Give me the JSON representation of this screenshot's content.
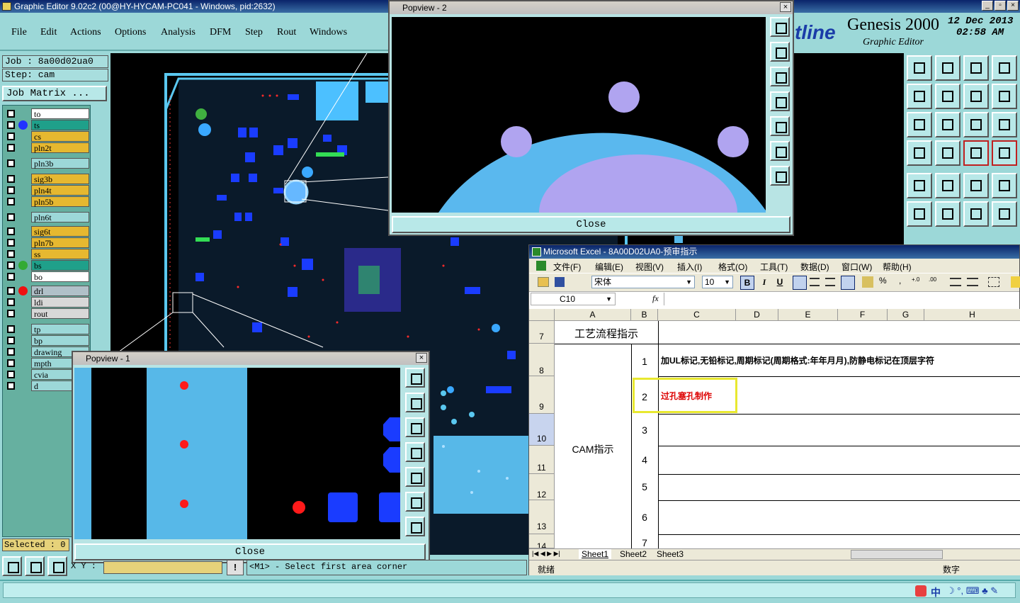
{
  "main_window": {
    "title": "Graphic Editor 9.02c2 (00@HY-HYCAM-PC041 - Windows, pid:2632)",
    "menu": [
      "File",
      "Edit",
      "Actions",
      "Options",
      "Analysis",
      "DFM",
      "Step",
      "Rout",
      "Windows"
    ]
  },
  "brand": {
    "partial_logo": "tline",
    "product": "Genesis 2000",
    "subtitle": "Graphic Editor",
    "date": "12 Dec 2013",
    "time": "02:58 AM"
  },
  "job": {
    "job_label": "Job : 8a00d02ua0",
    "step_label": "Step: cam",
    "matrix_button": "Job Matrix ..."
  },
  "layers": [
    {
      "name": "to",
      "bg": "#ffffff",
      "dot": ""
    },
    {
      "name": "ts",
      "bg": "#1fa08a",
      "dot": "#2233ff"
    },
    {
      "name": "cs",
      "bg": "#e6b830",
      "dot": ""
    },
    {
      "name": "pln2t",
      "bg": "#e6b830",
      "dot": ""
    },
    {
      "name": "pln3b",
      "bg": "#9cd8d8",
      "dot": ""
    },
    {
      "name": "sig3b",
      "bg": "#e6b830",
      "dot": ""
    },
    {
      "name": "pln4t",
      "bg": "#e6b830",
      "dot": ""
    },
    {
      "name": "pln5b",
      "bg": "#e6b830",
      "dot": ""
    },
    {
      "name": "pln6t",
      "bg": "#9cd8d8",
      "dot": ""
    },
    {
      "name": "sig6t",
      "bg": "#e6b830",
      "dot": ""
    },
    {
      "name": "pln7b",
      "bg": "#e6b830",
      "dot": ""
    },
    {
      "name": "ss",
      "bg": "#e6b830",
      "dot": ""
    },
    {
      "name": "bs",
      "bg": "#1fa08a",
      "dot": "#33aa33"
    },
    {
      "name": "bo",
      "bg": "#ffffff",
      "dot": ""
    },
    {
      "name": "drl",
      "bg": "#b0c0c8",
      "dot": "#ee1111"
    },
    {
      "name": "ldi",
      "bg": "#d8d8d8",
      "dot": ""
    },
    {
      "name": "rout",
      "bg": "#d8d8d8",
      "dot": ""
    },
    {
      "name": "tp",
      "bg": "#9cd8d8",
      "dot": ""
    },
    {
      "name": "bp",
      "bg": "#9cd8d8",
      "dot": ""
    },
    {
      "name": "drawing",
      "bg": "#9cd8d8",
      "dot": ""
    },
    {
      "name": "mpth",
      "bg": "#9cd8d8",
      "dot": ""
    },
    {
      "name": "cvia",
      "bg": "#9cd8d8",
      "dot": ""
    },
    {
      "name": "d",
      "bg": "#9cd8d8",
      "dot": ""
    }
  ],
  "selected_label": "Selected : 0",
  "coord_label": "X Y :",
  "prompt_text": "<M1> - Select first area corner",
  "popview2": {
    "title": "Popview - 2",
    "close": "Close"
  },
  "popview1": {
    "title": "Popview - 1",
    "close": "Close"
  },
  "excel": {
    "title": "Microsoft Excel - 8A00D02UA0-预审指示",
    "menu": [
      "文件(F)",
      "编辑(E)",
      "视图(V)",
      "插入(I)",
      "格式(O)",
      "工具(T)",
      "数据(D)",
      "窗口(W)",
      "帮助(H)"
    ],
    "font_name": "宋体",
    "font_size": "10",
    "cell_ref": "C10",
    "fx": "fx",
    "columns": [
      "A",
      "B",
      "C",
      "D",
      "E",
      "F",
      "G",
      "H"
    ],
    "row_numbers": [
      "7",
      "8",
      "9",
      "10",
      "11",
      "12",
      "13",
      "14"
    ],
    "header_text": "工艺流程指示",
    "group_label": "CAM指示",
    "items": [
      {
        "num": "1",
        "text": "加UL标记,无铅标记,周期标记(周期格式:年年月月),防静电标记在顶层字符",
        "color": "#000000"
      },
      {
        "num": "2",
        "text": "过孔塞孔制作",
        "color": "#dd0000"
      },
      {
        "num": "3",
        "text": "",
        "color": "#000000"
      },
      {
        "num": "4",
        "text": "",
        "color": "#000000"
      },
      {
        "num": "5",
        "text": "",
        "color": "#000000"
      },
      {
        "num": "6",
        "text": "",
        "color": "#000000"
      },
      {
        "num": "7",
        "text": "",
        "color": "#000000"
      }
    ],
    "sheets": [
      "Sheet1",
      "Sheet2",
      "Sheet3"
    ],
    "status_left": "就绪",
    "status_right": "数字"
  },
  "tray": {
    "ime": "中"
  }
}
